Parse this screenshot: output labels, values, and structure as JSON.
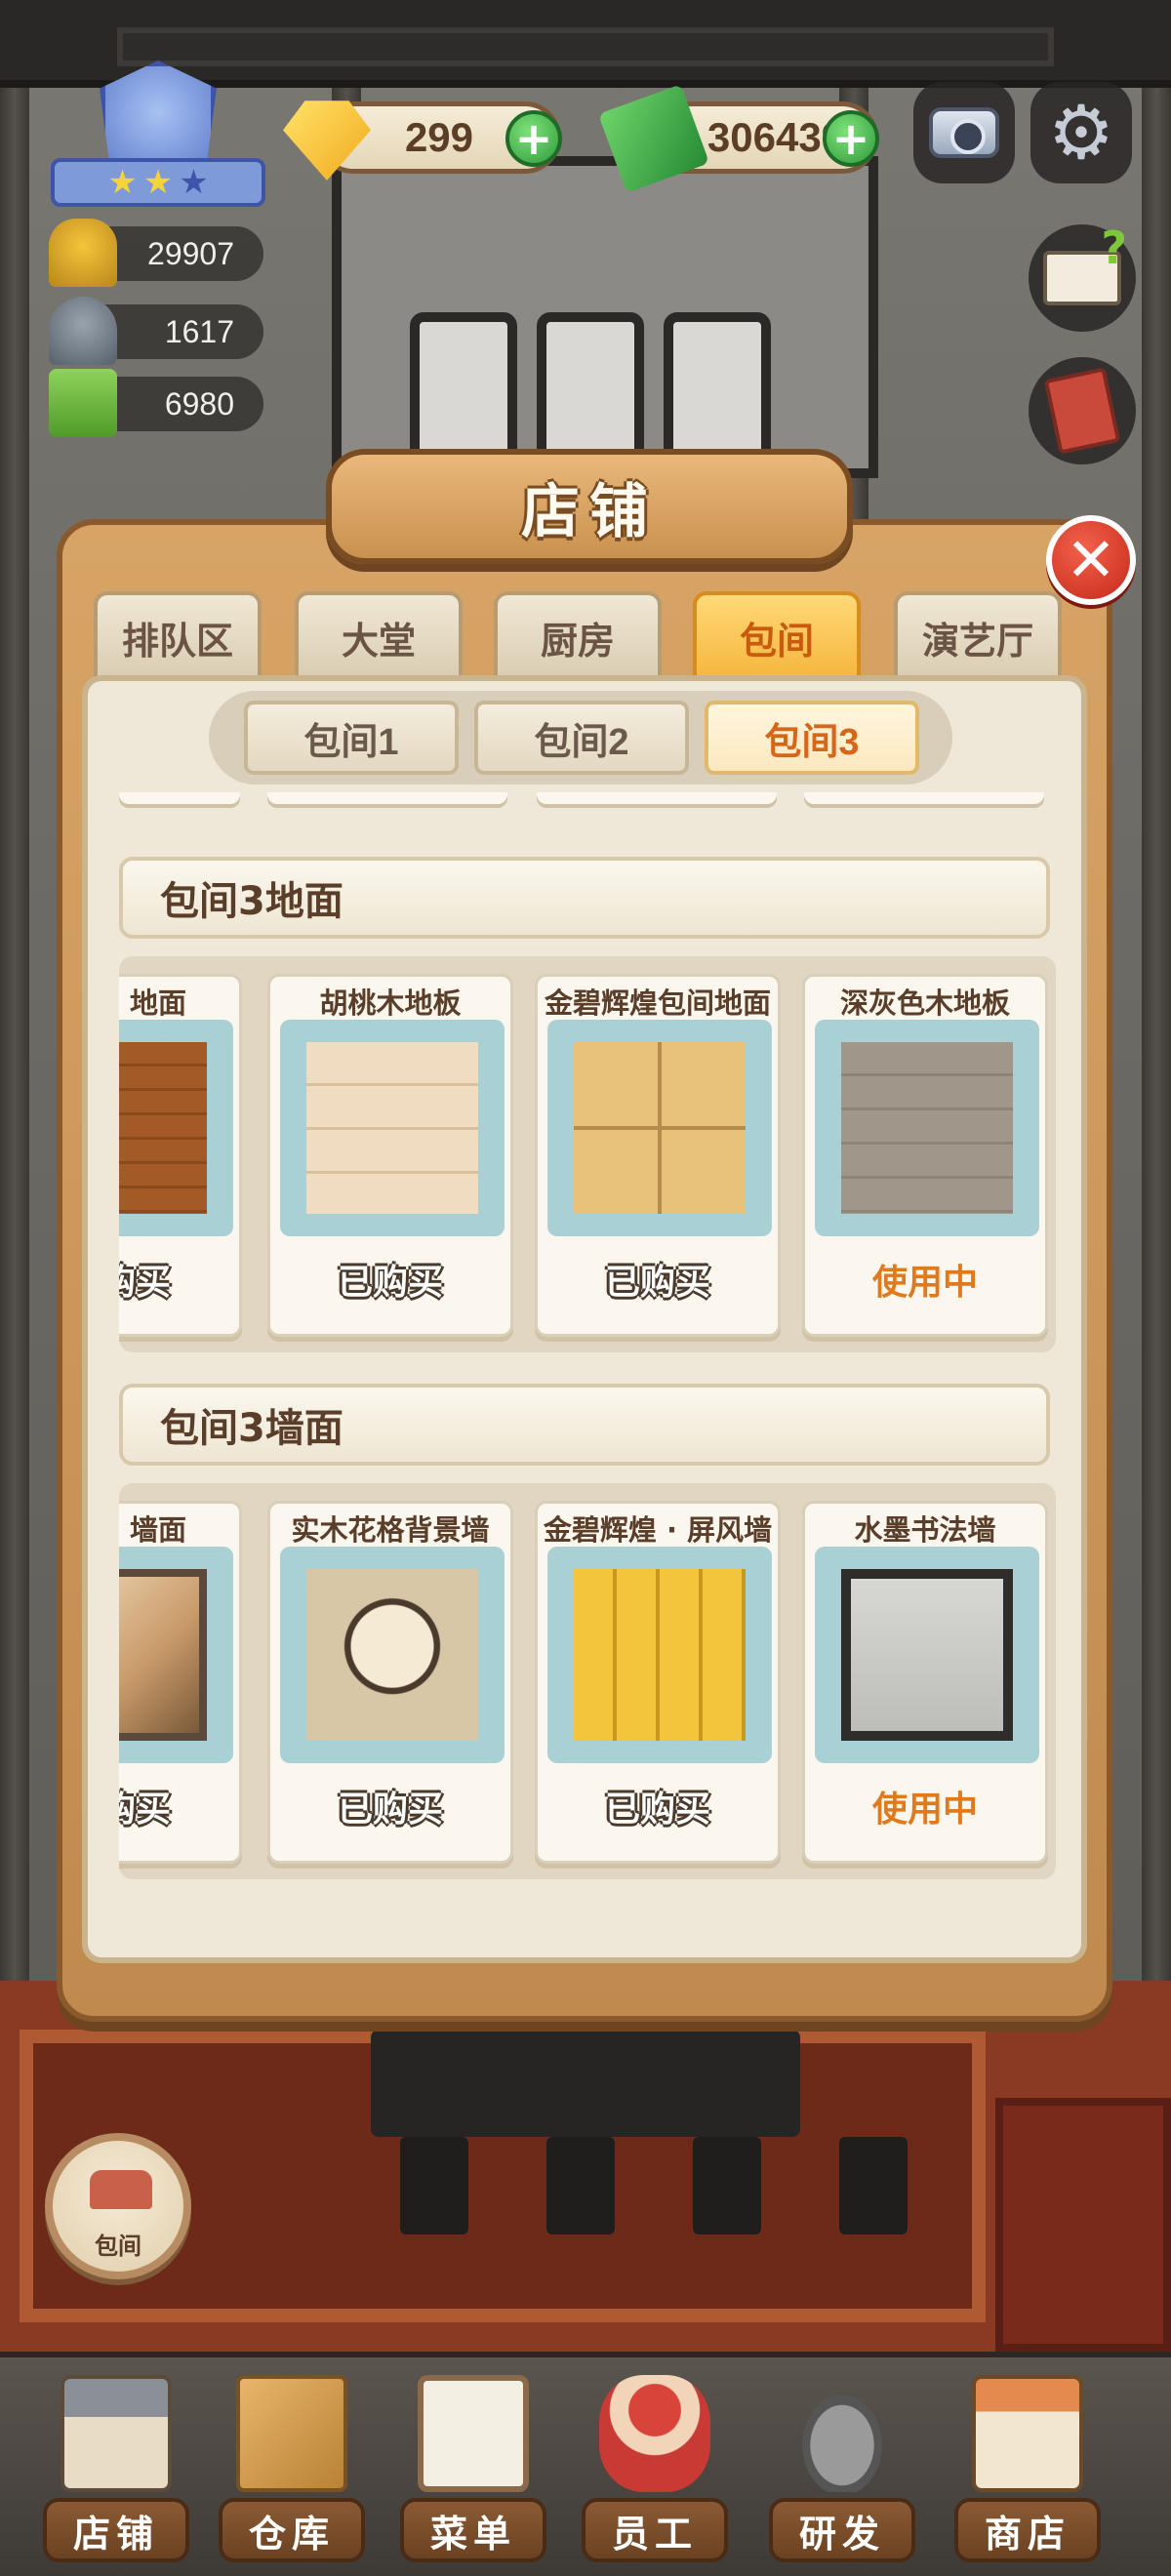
{
  "hud": {
    "gems": "299",
    "cash": "306439",
    "stats": {
      "popularity": "29907",
      "dishes": "1617",
      "menu_points": "6980"
    },
    "rank_stars_filled": 2,
    "rank_stars_total": 3
  },
  "panel": {
    "title": "店铺",
    "main_tabs": [
      "排队区",
      "大堂",
      "厨房",
      "包间",
      "演艺厅"
    ],
    "active_main_tab": "包间",
    "sub_tabs": [
      "包间1",
      "包间2",
      "包间3"
    ],
    "active_sub_tab": "包间3",
    "sections": [
      {
        "header": "包间3地面",
        "items": [
          {
            "name": "地面",
            "status": "购买"
          },
          {
            "name": "胡桃木地板",
            "status": "已购买"
          },
          {
            "name": "金碧辉煌包间地面",
            "status": "已购买"
          },
          {
            "name": "深灰色木地板",
            "status": "使用中"
          }
        ]
      },
      {
        "header": "包间3墙面",
        "items": [
          {
            "name": "墙面",
            "status": "购买"
          },
          {
            "name": "实木花格背景墙",
            "status": "已购买"
          },
          {
            "name": "金碧辉煌 · 屏风墙",
            "status": "已购买"
          },
          {
            "name": "水墨书法墙",
            "status": "使用中"
          }
        ]
      }
    ]
  },
  "room_button": {
    "label": "包间"
  },
  "bottom_nav": [
    "店铺",
    "仓库",
    "菜单",
    "员工",
    "研发",
    "商店"
  ],
  "colors": {
    "active_tab": "#f5b63c",
    "in_use_text": "#e07a1c",
    "close_button": "#c5281a",
    "plus_button": "#2f9a3a"
  },
  "icons": {
    "gem": "gem-icon",
    "cash": "cash-icon",
    "camera": "camera-icon",
    "settings": "gear-icon",
    "help_book": "help-book-icon",
    "recipe_book": "recipe-book-icon",
    "close": "close-icon"
  }
}
